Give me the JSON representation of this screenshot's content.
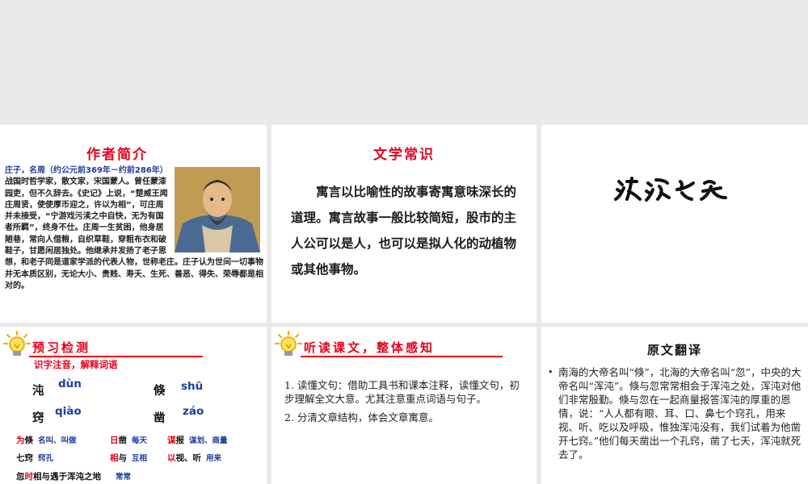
{
  "slide_author": {
    "title": "作者简介",
    "bio_lead": "庄子，名周（约公元前369年－约前286年）",
    "bio_body": "战国时哲学家，散文家，宋国蒙人。曾任蒙漆园吏，但不久辞去。《史记》上说，“楚威王闻庄周贤，使使厚币迎之，许以为相”，可庄周并未接受，“宁游戏污渎之中自快，无为有国者所羁”，终身不仕。庄周一生贫困，他身居陋巷，常向人借粮，自织草鞋，穿粗布衣和破鞋子，甘愿闲居独处。他继承并发扬了老子思想，和老子同是道家学派的代表人物，世称老庄。庄子认为世间一切事物并无本质区别，无论大小、贵贱、寿夭、生死、善恶、得失、荣辱都是相对的。",
    "portrait_icon": "zhuangzi-portrait"
  },
  "slide_literature": {
    "title": "文学常识",
    "body": "寓言以比喻性的故事寄寓意味深长的道理。寓言故事一般比较简短，股市的主人公可以是人，也可以是拟人化的动植物或其他事物。"
  },
  "slide_title": {
    "calligraphy_icon": "calligraphy-title-hundun-zhi-si"
  },
  "slide_preview": {
    "title": "预习检测",
    "subtitle": "识字注音，解释词语",
    "pinyin": [
      {
        "char": "沌",
        "py": "dùn"
      },
      {
        "char": "倏",
        "py": "shū"
      },
      {
        "char": "窍",
        "py": "qiào"
      },
      {
        "char": "凿",
        "py": "záo"
      }
    ],
    "definitions": [
      {
        "red": "为",
        "rest": "倏",
        "meaning": "名叫、叫做"
      },
      {
        "red": "日",
        "rest": "凿",
        "meaning": "每天"
      },
      {
        "red": "谋",
        "rest": "报",
        "meaning": "谋划、商量"
      },
      {
        "red": "",
        "rest": "七窍",
        "meaning": "窍孔"
      },
      {
        "red": "相",
        "rest": "与",
        "meaning": "互相"
      },
      {
        "red": "以",
        "rest": "视、听",
        "meaning": "用来"
      },
      {
        "red": "时",
        "pre": "忽",
        "rest": "相与遇于浑沌之地",
        "meaning": "常常"
      }
    ],
    "bulb_icon": "lightbulb-icon"
  },
  "slide_listen": {
    "title": "听读课文，整体感知",
    "steps": [
      "1. 读懂文句：借助工具书和课本注释，读懂文句，初步理解全文大意。尤其注意重点词语与句子。",
      "2. 分清文章结构，体会文章寓意。"
    ],
    "bulb_icon": "lightbulb-icon"
  },
  "slide_translation": {
    "title": "原文翻译",
    "bullet": "•",
    "text": "南海的大帝名叫“倏”，北海的大帝名叫“忽”，中央的大帝名叫“浑沌”。倏与忽常常相会于浑沌之处，浑沌对他们非常殷勤。倏与忽在一起商量报答浑沌的厚重的恩情，说：“人人都有眼、耳、口、鼻七个窍孔，用来视、听、吃以及呼吸，惟独浑沌没有，我们试着为他凿开七窍。”他们每天凿出一个孔窍，凿了七天，浑沌就死去了。"
  },
  "colors": {
    "accent_red": "#e8001a",
    "accent_blue": "#1c3f9e",
    "background": "#e9e9e9"
  }
}
